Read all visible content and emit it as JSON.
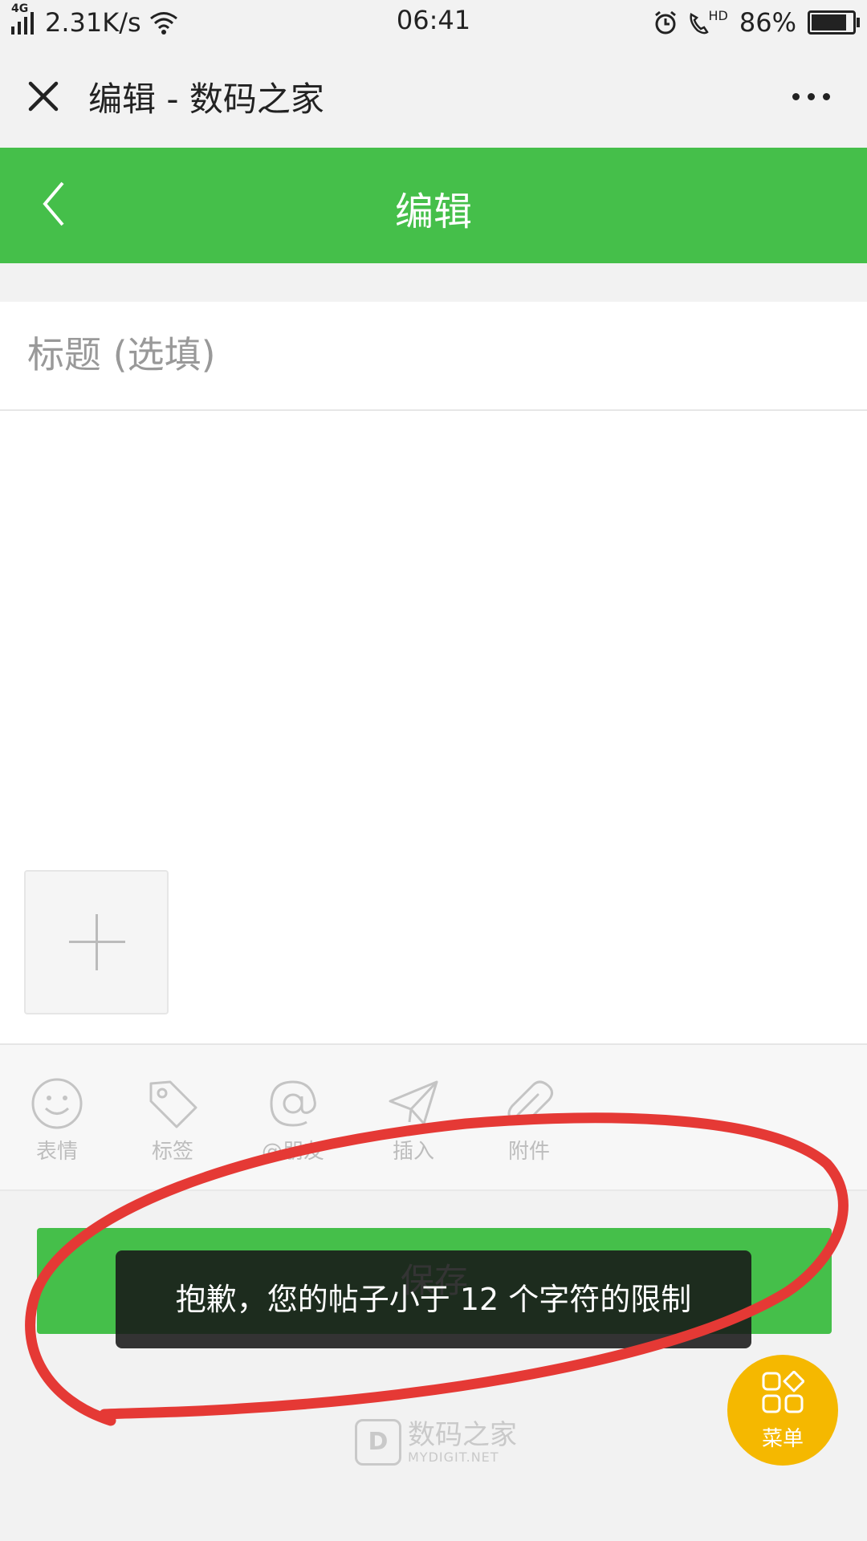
{
  "status_bar": {
    "network": "4G",
    "speed": "2.31K/s",
    "time": "06:41",
    "hd": "HD",
    "battery": "86%",
    "battery_level": 0.86
  },
  "webview": {
    "title": "编辑 - 数码之家"
  },
  "navbar": {
    "title": "编辑"
  },
  "editor": {
    "title_placeholder": "标题 (选填)"
  },
  "toolbar": {
    "items": [
      {
        "label": "表情",
        "icon": "smiley-icon"
      },
      {
        "label": "标签",
        "icon": "tag-icon"
      },
      {
        "label": "@朋友",
        "icon": "at-icon"
      },
      {
        "label": "插入",
        "icon": "paper-plane-icon"
      },
      {
        "label": "附件",
        "icon": "paperclip-icon"
      }
    ]
  },
  "save_button": {
    "label": "保存"
  },
  "toast": {
    "message": "抱歉，您的帖子小于 12 个字符的限制"
  },
  "watermark": {
    "badge": "D",
    "cn": "数码之家",
    "en": "MYDIGIT.NET"
  },
  "fab": {
    "label": "菜单",
    "icon": "grid-icon"
  },
  "colors": {
    "green": "#45bf4a",
    "fab": "#f5b800",
    "annotation": "#e53935"
  }
}
